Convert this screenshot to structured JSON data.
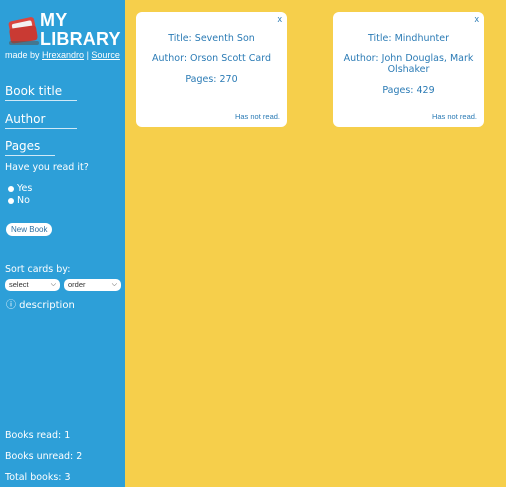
{
  "app": {
    "title_line1": "MY",
    "title_line2": "LIBRARY",
    "made_by_prefix": "made by ",
    "author_link": "Hrexandro",
    "separator": " | ",
    "source_link": "Source"
  },
  "form": {
    "book_title_label": "Book title",
    "author_label": "Author",
    "pages_label": "Pages",
    "read_question": "Have you read it?",
    "radio_yes": "Yes",
    "radio_no": "No",
    "new_book_button": "New Book"
  },
  "sort": {
    "label": "Sort cards by:",
    "field_select": "select",
    "order_select": "order",
    "description_link": "ⓘ description"
  },
  "stats": {
    "read": "Books read: 1",
    "unread": "Books unread: 2",
    "total": "Total books: 3"
  },
  "cards": [
    {
      "close": "x",
      "title": "Title: Seventh Son",
      "author": "Author: Orson Scott Card",
      "pages": "Pages: 270",
      "status": "Has not read."
    },
    {
      "close": "x",
      "title": "Title: Mindhunter",
      "author_line1": "Author: John Douglas, Mark",
      "author_line2": "Olshaker",
      "pages": "Pages: 429",
      "status": "Has not read."
    }
  ],
  "colors": {
    "sidebar": "#2d9fd8",
    "background": "#f6cf4b",
    "card_text": "#2b7bb5",
    "logo_book": "#d9463f"
  },
  "icons": {
    "logo": "book-icon",
    "select_arrow": "chevron-down-icon",
    "info": "info-icon"
  }
}
